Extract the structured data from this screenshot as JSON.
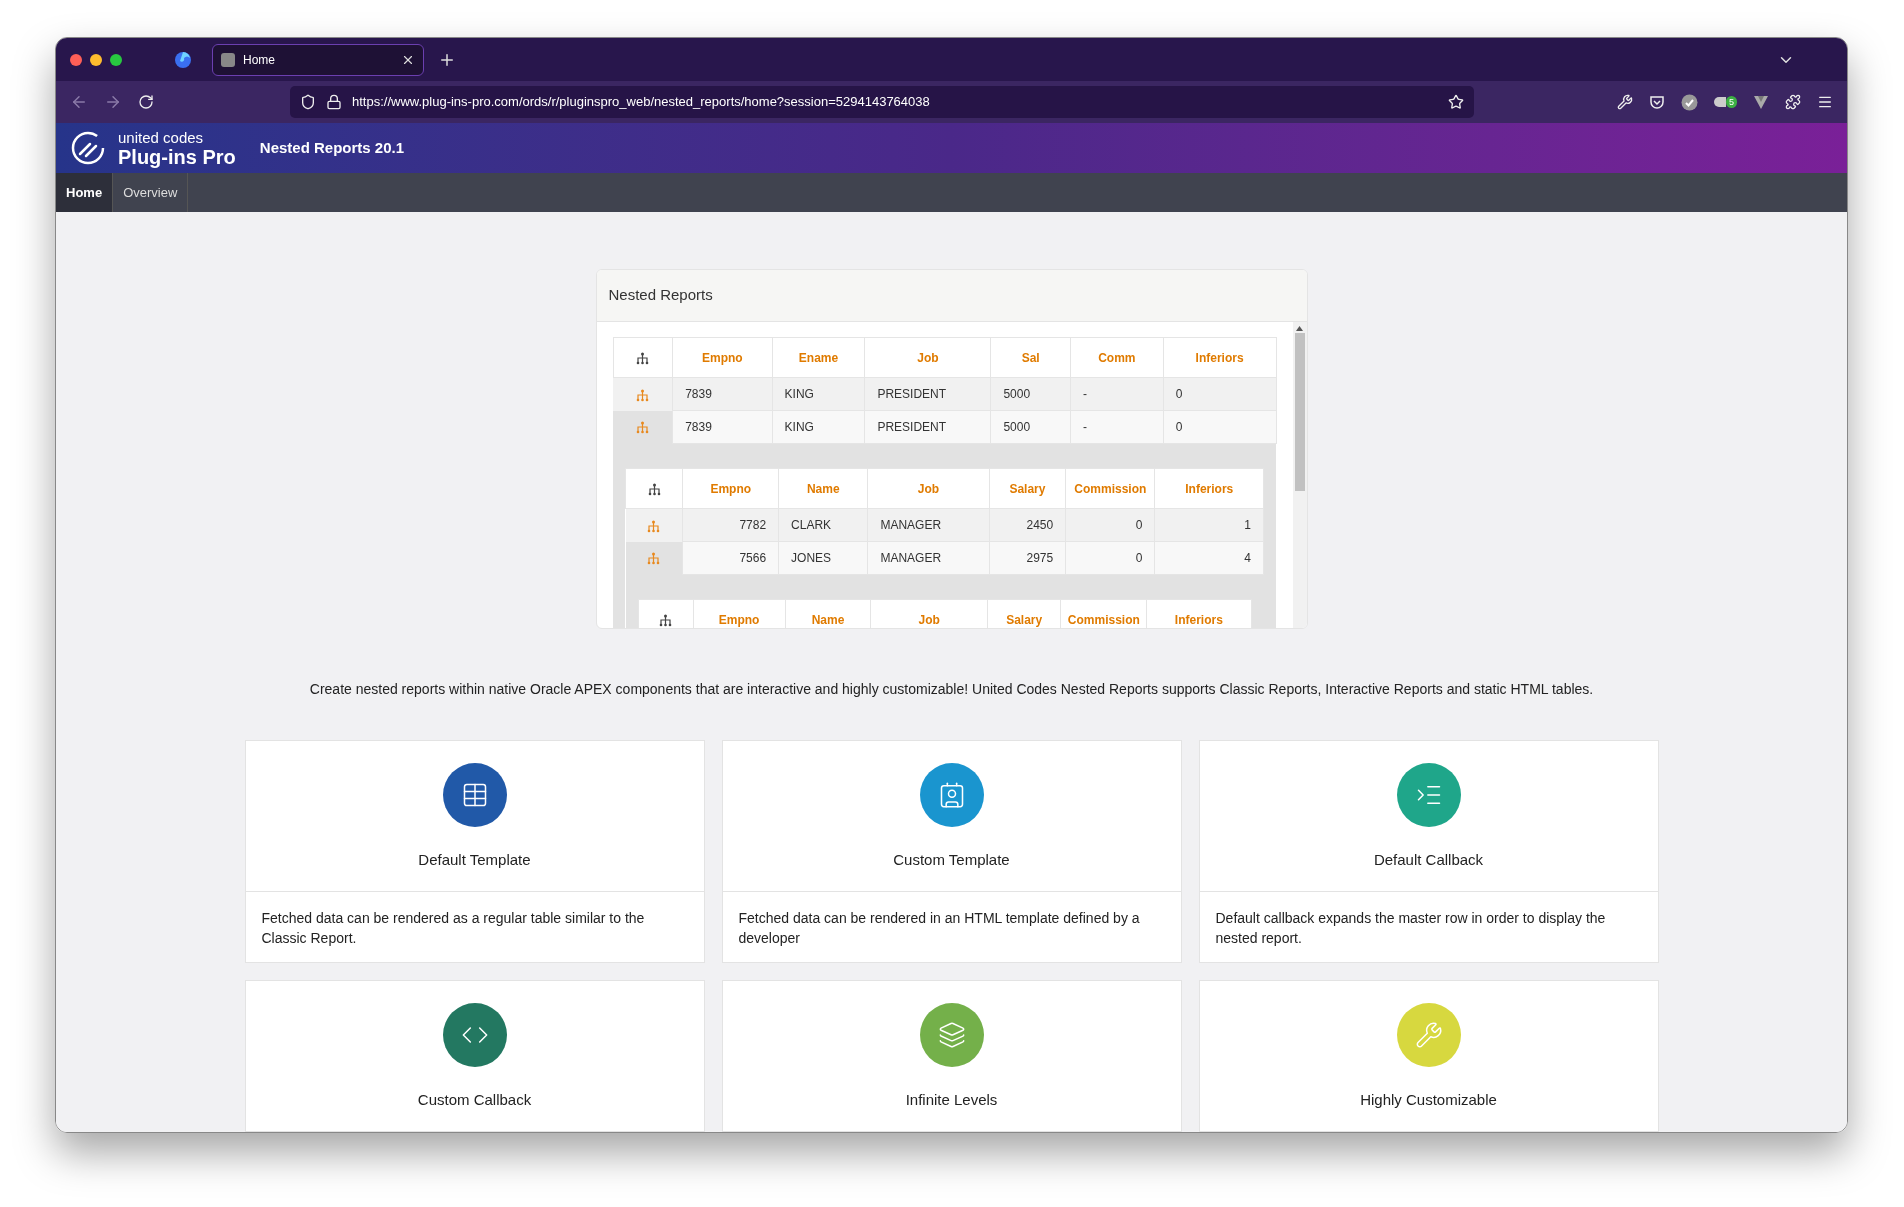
{
  "browser": {
    "tab": {
      "title": "Home",
      "selected": true
    },
    "url": "https://www.plug-ins-pro.com/ords/r/pluginspro_web/nested_reports/home?session=5294143764038",
    "extension_badge": "5"
  },
  "app": {
    "brand_top": "united codes",
    "brand": "Plug-ins Pro",
    "title": "Nested Reports 20.1"
  },
  "nav": [
    {
      "label": "Home",
      "selected": true
    },
    {
      "label": "Overview",
      "selected": false
    }
  ],
  "report": {
    "title": "Nested Reports",
    "table": {
      "columns": [
        "Empno",
        "Ename",
        "Job",
        "Sal",
        "Comm",
        "Inferiors"
      ],
      "rows": [
        {
          "cells": [
            "7839",
            "KING",
            "PRESIDENT",
            "5000",
            "-",
            "0"
          ],
          "expanded": false
        },
        {
          "cells": [
            "7839",
            "KING",
            "PRESIDENT",
            "5000",
            "-",
            "0"
          ],
          "expanded": true,
          "nested": {
            "columns": [
              "Empno",
              "Name",
              "Job",
              "Salary",
              "Commission",
              "Inferiors"
            ],
            "rows": [
              {
                "cells": [
                  "7782",
                  "CLARK",
                  "MANAGER",
                  "2450",
                  "0",
                  "1"
                ],
                "expanded": false
              },
              {
                "cells": [
                  "7566",
                  "JONES",
                  "MANAGER",
                  "2975",
                  "0",
                  "4"
                ],
                "expanded": true,
                "nested": {
                  "columns": [
                    "Empno",
                    "Name",
                    "Job",
                    "Salary",
                    "Commission",
                    "Inferiors"
                  ]
                }
              }
            ]
          }
        }
      ]
    }
  },
  "description": "Create nested reports within native Oracle APEX components that are interactive and highly customizable! United Codes Nested Reports supports Classic Reports, Interactive Reports and static HTML tables.",
  "features": [
    {
      "title": "Default Template",
      "text": "Fetched data can be rendered as a regular table similar to the Classic Report.",
      "color": "#2159a8"
    },
    {
      "title": "Custom Template",
      "text": "Fetched data can be rendered in an HTML template defined by a developer",
      "color": "#1a95cf"
    },
    {
      "title": "Default Callback",
      "text": "Default callback expands the master row in order to display the nested report.",
      "color": "#1fa68a"
    },
    {
      "title": "Custom Callback",
      "color": "#237861"
    },
    {
      "title": "Infinite Levels",
      "color": "#74b04a"
    },
    {
      "title": "Highly Customizable",
      "color": "#d7d83f"
    }
  ]
}
